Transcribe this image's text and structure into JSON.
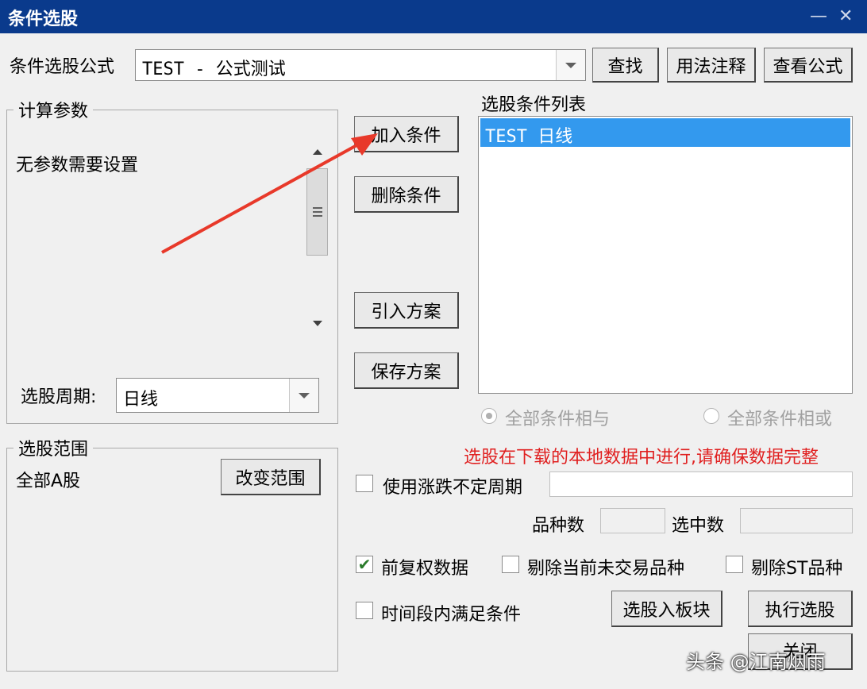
{
  "window": {
    "title": "条件选股",
    "minimize_symbol": "—",
    "close_symbol": "✕"
  },
  "formula": {
    "label": "条件选股公式",
    "value": "TEST  -  公式测试",
    "find_button": "查找",
    "usage_button": "用法注释",
    "view_button": "查看公式"
  },
  "params": {
    "legend": "计算参数",
    "message": "无参数需要设置",
    "period_label": "选股周期:",
    "period_value": "日线"
  },
  "actions": {
    "add_condition": "加入条件",
    "delete_condition": "删除条件",
    "import_plan": "引入方案",
    "save_plan": "保存方案"
  },
  "conditions": {
    "title": "选股条件列表",
    "items": [
      {
        "label": "TEST  日线"
      }
    ],
    "radio_and": "全部条件相与",
    "radio_or": "全部条件相或",
    "warning": "选股在下载的本地数据中进行,请确保数据完整",
    "warning_color": "#e02020",
    "selected_color": "#3399ee"
  },
  "range": {
    "legend": "选股范围",
    "value": "全部A股",
    "change_button": "改变范围"
  },
  "options": {
    "variable_period": {
      "label": "使用涨跌不定周期",
      "checked": false
    },
    "variety_count_label": "品种数",
    "selected_count_label": "选中数",
    "forward_adjust": {
      "label": "前复权数据",
      "checked": true
    },
    "exclude_untraded": {
      "label": "剔除当前未交易品种",
      "checked": false
    },
    "exclude_st": {
      "label": "剔除ST品种",
      "checked": false
    },
    "time_range": {
      "label": "时间段内满足条件",
      "checked": false
    },
    "to_block_button": "选股入板块",
    "execute_button": "执行选股",
    "close_button": "关闭"
  },
  "watermark": "头条 @江南烟雨"
}
